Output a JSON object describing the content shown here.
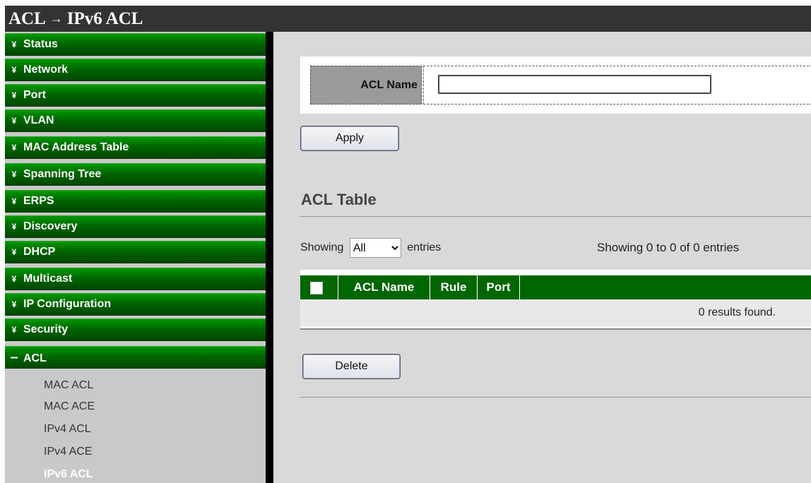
{
  "breadcrumb": {
    "section": "ACL",
    "separator": "→",
    "page": "IPv6 ACL"
  },
  "menu": {
    "collapsed_marker": "¥",
    "expanded_marker": "–",
    "items": [
      {
        "label": "Status"
      },
      {
        "label": "Network"
      },
      {
        "label": "Port"
      },
      {
        "label": "VLAN"
      },
      {
        "label": "MAC Address Table"
      },
      {
        "label": "Spanning Tree"
      },
      {
        "label": "ERPS"
      },
      {
        "label": "Discovery"
      },
      {
        "label": "DHCP"
      },
      {
        "label": "Multicast"
      },
      {
        "label": "IP Configuration"
      },
      {
        "label": "Security"
      },
      {
        "label": "ACL"
      }
    ],
    "subitems": [
      {
        "label": "MAC ACL"
      },
      {
        "label": "MAC ACE"
      },
      {
        "label": "IPv4 ACL"
      },
      {
        "label": "IPv4 ACE"
      },
      {
        "label": "IPv6 ACL"
      }
    ]
  },
  "form": {
    "acl_name_label": "ACL Name",
    "acl_name_value": "",
    "apply_label": "Apply"
  },
  "table": {
    "title": "ACL Table",
    "showing_prefix": "Showing",
    "entries_select_value": "All",
    "showing_suffix": "entries",
    "page_info": "Showing 0 to 0 of 0 entries",
    "columns": [
      "ACL Name",
      "Rule",
      "Port"
    ],
    "empty_message": "0 results found.",
    "delete_label": "Delete"
  },
  "colors": {
    "menu_green": "#006600",
    "header_bar": "#333333",
    "content_bg": "#d9d9d9",
    "sidebar_bg": "#c9c9c9"
  }
}
